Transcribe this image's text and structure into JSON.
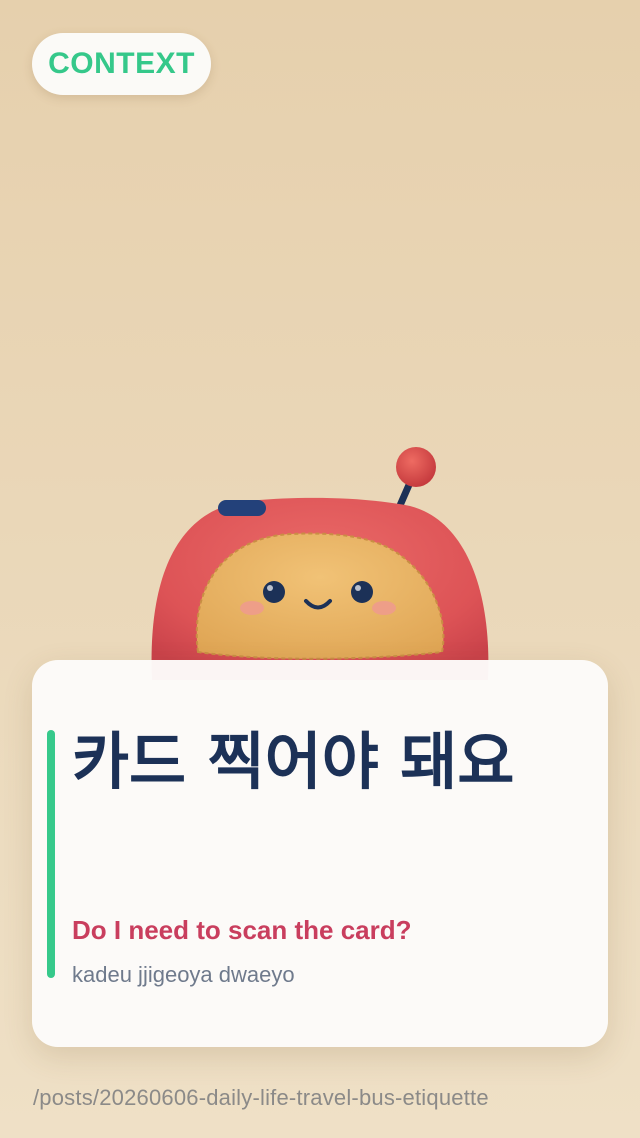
{
  "context_badge": {
    "label": "CONTEXT",
    "color": "#35c88a"
  },
  "mascot": {
    "icon": "red-robot-mascot-icon",
    "colors": {
      "body": "#e0575a",
      "face": "#eab460",
      "antenna_ball": "#d94a4a",
      "features": "#1c3157"
    }
  },
  "phrase_card": {
    "korean": "카드 찍어야 돼요",
    "english": "Do I need to scan the card?",
    "romanization": "kadeu jjigeoya dwaeyo",
    "accent_color": "#36c98b",
    "korean_color": "#1c3157",
    "english_color": "#c93e5e"
  },
  "footer": {
    "path": "/posts/20260606-daily-life-travel-bus-etiquette"
  }
}
